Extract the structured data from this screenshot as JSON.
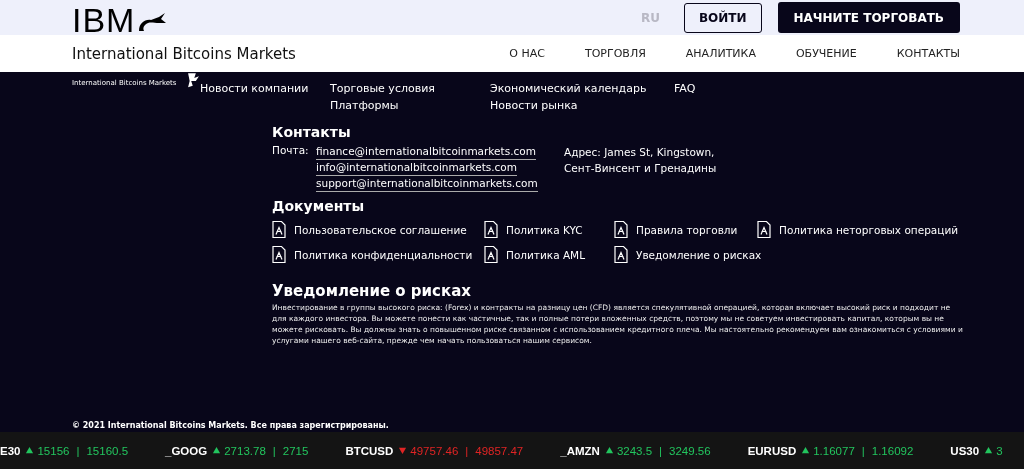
{
  "header": {
    "logo": "IBM",
    "brand": "International Bitcoins Markets",
    "language": "RU",
    "login_button": "ВОЙТИ",
    "cta_button": "НАЧНИТЕ ТОРГОВАТЬ",
    "nav": [
      "О НАС",
      "ТОРГОВЛЯ",
      "АНАЛИТИКА",
      "ОБУЧЕНИЕ",
      "КОНТАКТЫ"
    ]
  },
  "footer": {
    "logo_caption": "International Bitcoins Markets",
    "link_columns": [
      [
        "Новости компании"
      ],
      [
        "Торговые условия",
        "Платформы"
      ],
      [
        "Экономический календарь",
        "Новости рынка"
      ],
      [
        "FAQ"
      ]
    ],
    "contacts": {
      "title": "Контакты",
      "mail_label": "Почта:",
      "emails": [
        "finance@internationalbitcoinmarkets.com",
        "info@internationalbitcoinmarkets.com",
        "support@internationalbitcoinmarkets.com"
      ],
      "address": [
        "Адрес: James St, Kingstown,",
        "Сент-Винсент и Гренадины"
      ]
    },
    "documents": {
      "title": "Документы",
      "items": [
        {
          "label": "Пользовательское соглашение"
        },
        {
          "label": "Политика KYC"
        },
        {
          "label": "Правила торговли"
        },
        {
          "label": "Политика неторговых операций"
        },
        {
          "label": "Политика конфиденциальности"
        },
        {
          "label": "Политика AML"
        },
        {
          "label": "Уведомление о рисках"
        }
      ]
    },
    "risk": {
      "title": "Уведомление о рисках",
      "text": "Инвестирование в группы высокого риска: (Forex) и контракты на разницу цен (CFD) является спекулятивной операцией, которая включает высокий риск и подходит не для каждого инвестора. Вы можете понести как частичные, так и полные потери вложенных средств, поэтому мы не советуем инвестировать капитал, которым вы не можете рисковать. Вы должны знать о повышенном риске связанном с использованием кредитного плеча. Мы настоятельно рекомендуем вам ознакомиться с условиями и услугами нашего веб-сайта, прежде чем начать пользоваться нашим сервисом."
    },
    "copyright": "© 2021 International Bitcoins Markets. Все права зарегистрированы."
  },
  "ticker": [
    {
      "symbol": "E30",
      "kind": "up",
      "bid": "15156",
      "separator": "|",
      "ask": "15160.5"
    },
    {
      "symbol": "_GOOG",
      "kind": "up",
      "bid": "2713.78",
      "separator": "|",
      "ask": "2715"
    },
    {
      "symbol": "BTCUSD",
      "kind": "down",
      "bid": "49757.46",
      "separator": "|",
      "ask": "49857.47"
    },
    {
      "symbol": "_AMZN",
      "kind": "up",
      "bid": "3243.5",
      "separator": "|",
      "ask": "3249.56"
    },
    {
      "symbol": "EURUSD",
      "kind": "up",
      "bid": "1.16077",
      "separator": "|",
      "ask": "1.16092"
    },
    {
      "symbol": "US30",
      "kind": "up",
      "bid": "3"
    }
  ]
}
